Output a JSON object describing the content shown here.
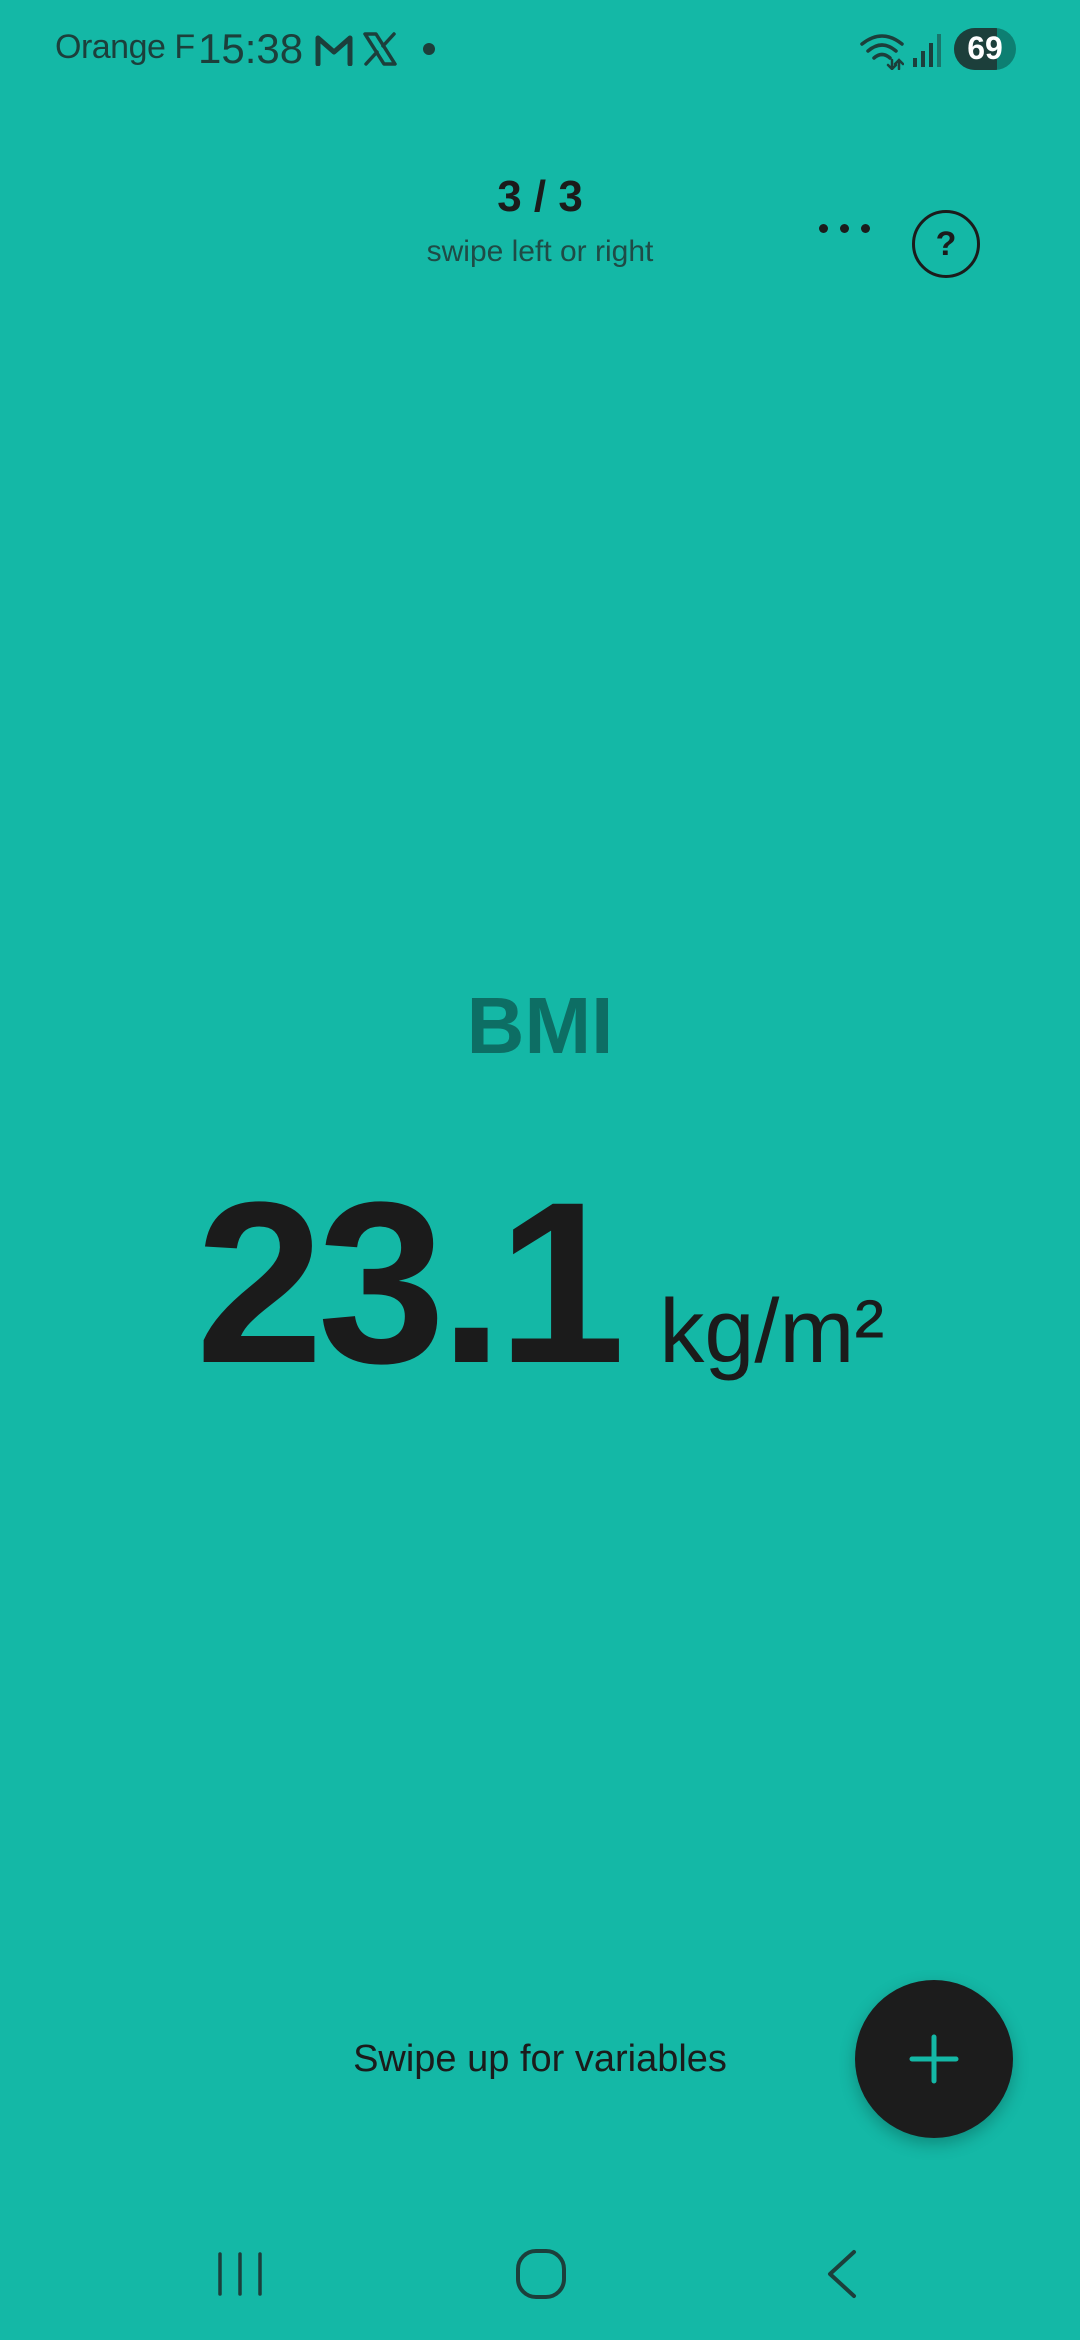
{
  "status_bar": {
    "carrier": "Orange F",
    "time": "15:38",
    "battery_level": "69",
    "battery_fraction": 0.69,
    "icons": [
      "gmail-icon",
      "x-icon",
      "dot-icon",
      "wifi-icon",
      "signal-icon",
      "battery-icon"
    ]
  },
  "header": {
    "page_indicator": "3 / 3",
    "swipe_hint": "swipe left or right",
    "more_icon": "more-horizontal-icon",
    "help_label": "?"
  },
  "result": {
    "title": "BMI",
    "value": "23.1",
    "unit": "kg/m²"
  },
  "bottom": {
    "swipe_up_hint": "Swipe up for variables",
    "fab_icon": "plus-icon"
  },
  "nav_bar": {
    "icons": [
      "recents-icon",
      "home-icon",
      "back-icon"
    ]
  },
  "colors": {
    "background": "#14b8a6",
    "title_accent": "#0d6e64",
    "text": "#1b1b1b",
    "fab": "#1c1c1c",
    "fab_icon": "#14b8a6"
  }
}
